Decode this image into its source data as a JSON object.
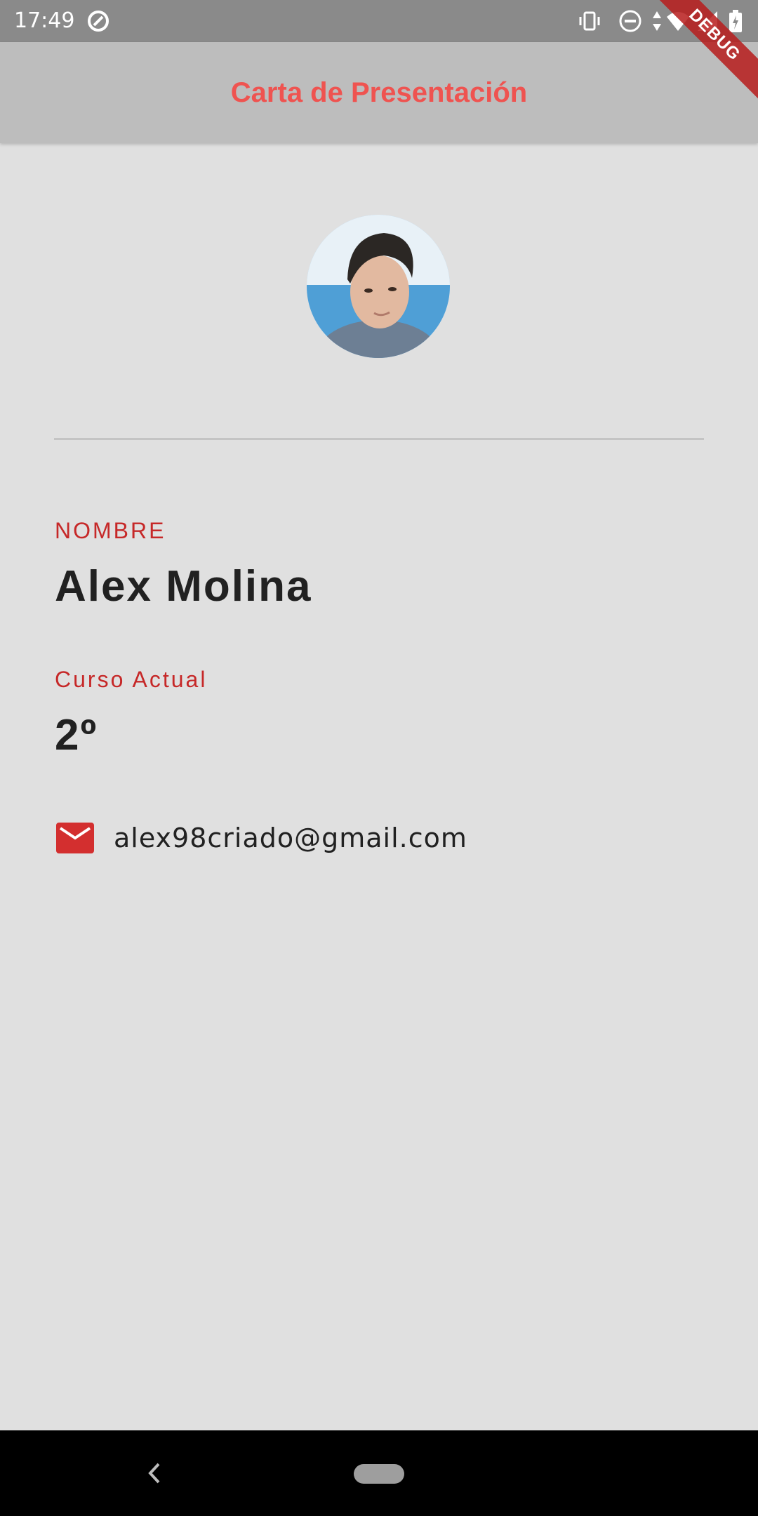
{
  "status_bar": {
    "time": "17:49",
    "left_icons": [
      "sync-icon"
    ],
    "right_icons": [
      "vibrate-icon",
      "do-not-disturb-icon",
      "data-arrows-icon",
      "wifi-icon",
      "signal-icon",
      "battery-icon"
    ]
  },
  "app_bar": {
    "title": "Carta de Presentación",
    "debug_banner": "DEBUG"
  },
  "profile": {
    "name_label": "NOMBRE",
    "name_value": "Alex Molina",
    "course_label": "Curso Actual",
    "course_value": "2º",
    "email": "alex98criado@gmail.com",
    "email_icon": "mail-icon"
  },
  "nav_bar": {
    "icons": [
      "back-icon",
      "home-pill-icon"
    ]
  },
  "colors": {
    "app_bar_bg": "#bdbdbd",
    "title": "#ef5350",
    "label": "#c62828",
    "background": "#e0e0e0",
    "accent_red": "#d32f2f"
  }
}
